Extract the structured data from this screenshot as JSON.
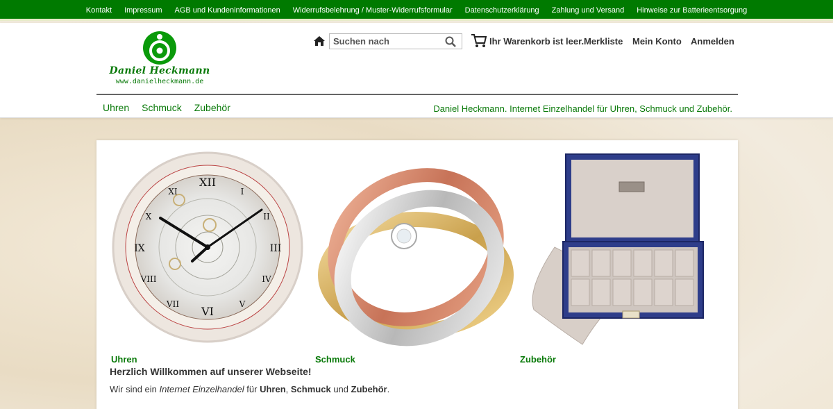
{
  "topbar": {
    "links": [
      "Kontakt",
      "Impressum",
      "AGB und Kundeninformationen",
      "Widerrufsbelehrung / Muster-Widerrufsformular",
      "Datenschutzerklärung",
      "Zahlung und Versand",
      "Hinweise zur Batterieentsorgung"
    ]
  },
  "logo": {
    "name": "Daniel Heckmann",
    "url": "www.danielheckmann.de"
  },
  "search": {
    "placeholder": "Suchen nach"
  },
  "cart": {
    "status": "Ihr Warenkorb ist leer."
  },
  "account_links": {
    "wishlist": "Merkliste",
    "account": "Mein Konto",
    "login": "Anmelden"
  },
  "nav": {
    "items": [
      "Uhren",
      "Schmuck",
      "Zubehör"
    ]
  },
  "tagline": "Daniel Heckmann.  Internet Einzelhandel für Uhren, Schmuck und Zubehör.",
  "categories": [
    {
      "label": "Uhren"
    },
    {
      "label": "Schmuck"
    },
    {
      "label": "Zubehör"
    }
  ],
  "welcome": {
    "heading": "Herzlich Willkommen auf unserer Webseite!",
    "text_1": "Wir sind ein ",
    "text_italic": "Internet Einzelhandel",
    "text_2": " für ",
    "bold_1": "Uhren",
    "text_3": ", ",
    "bold_2": "Schmuck",
    "text_4": " und ",
    "bold_3": "Zubehör",
    "text_5": "."
  },
  "colors": {
    "brand_green": "#007a00",
    "link_green": "#0a7a0a"
  }
}
